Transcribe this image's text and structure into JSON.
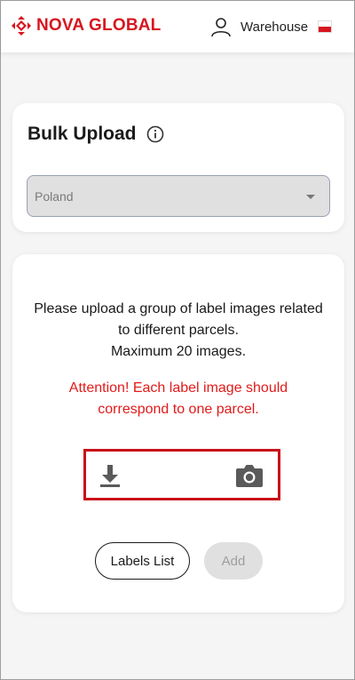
{
  "header": {
    "brand": "NOVA GLOBAL",
    "user_label": "Warehouse",
    "flag": "poland-flag",
    "brand_color": "#d7161f"
  },
  "bulk_upload": {
    "title": "Bulk Upload",
    "info_icon": "info-icon",
    "country_select": {
      "value": "Poland"
    }
  },
  "upload_panel": {
    "description_line1": "Please upload a group of label images related",
    "description_line2": "to different parcels.",
    "description_line3": "Maximum 20 images.",
    "attention_line1": "Attention! Each label image should",
    "attention_line2": "correspond to one parcel.",
    "attention_color": "#e21a1a",
    "upload_icon": "download-icon",
    "camera_icon": "camera-icon",
    "labels_list_label": "Labels List",
    "add_label": "Add"
  }
}
